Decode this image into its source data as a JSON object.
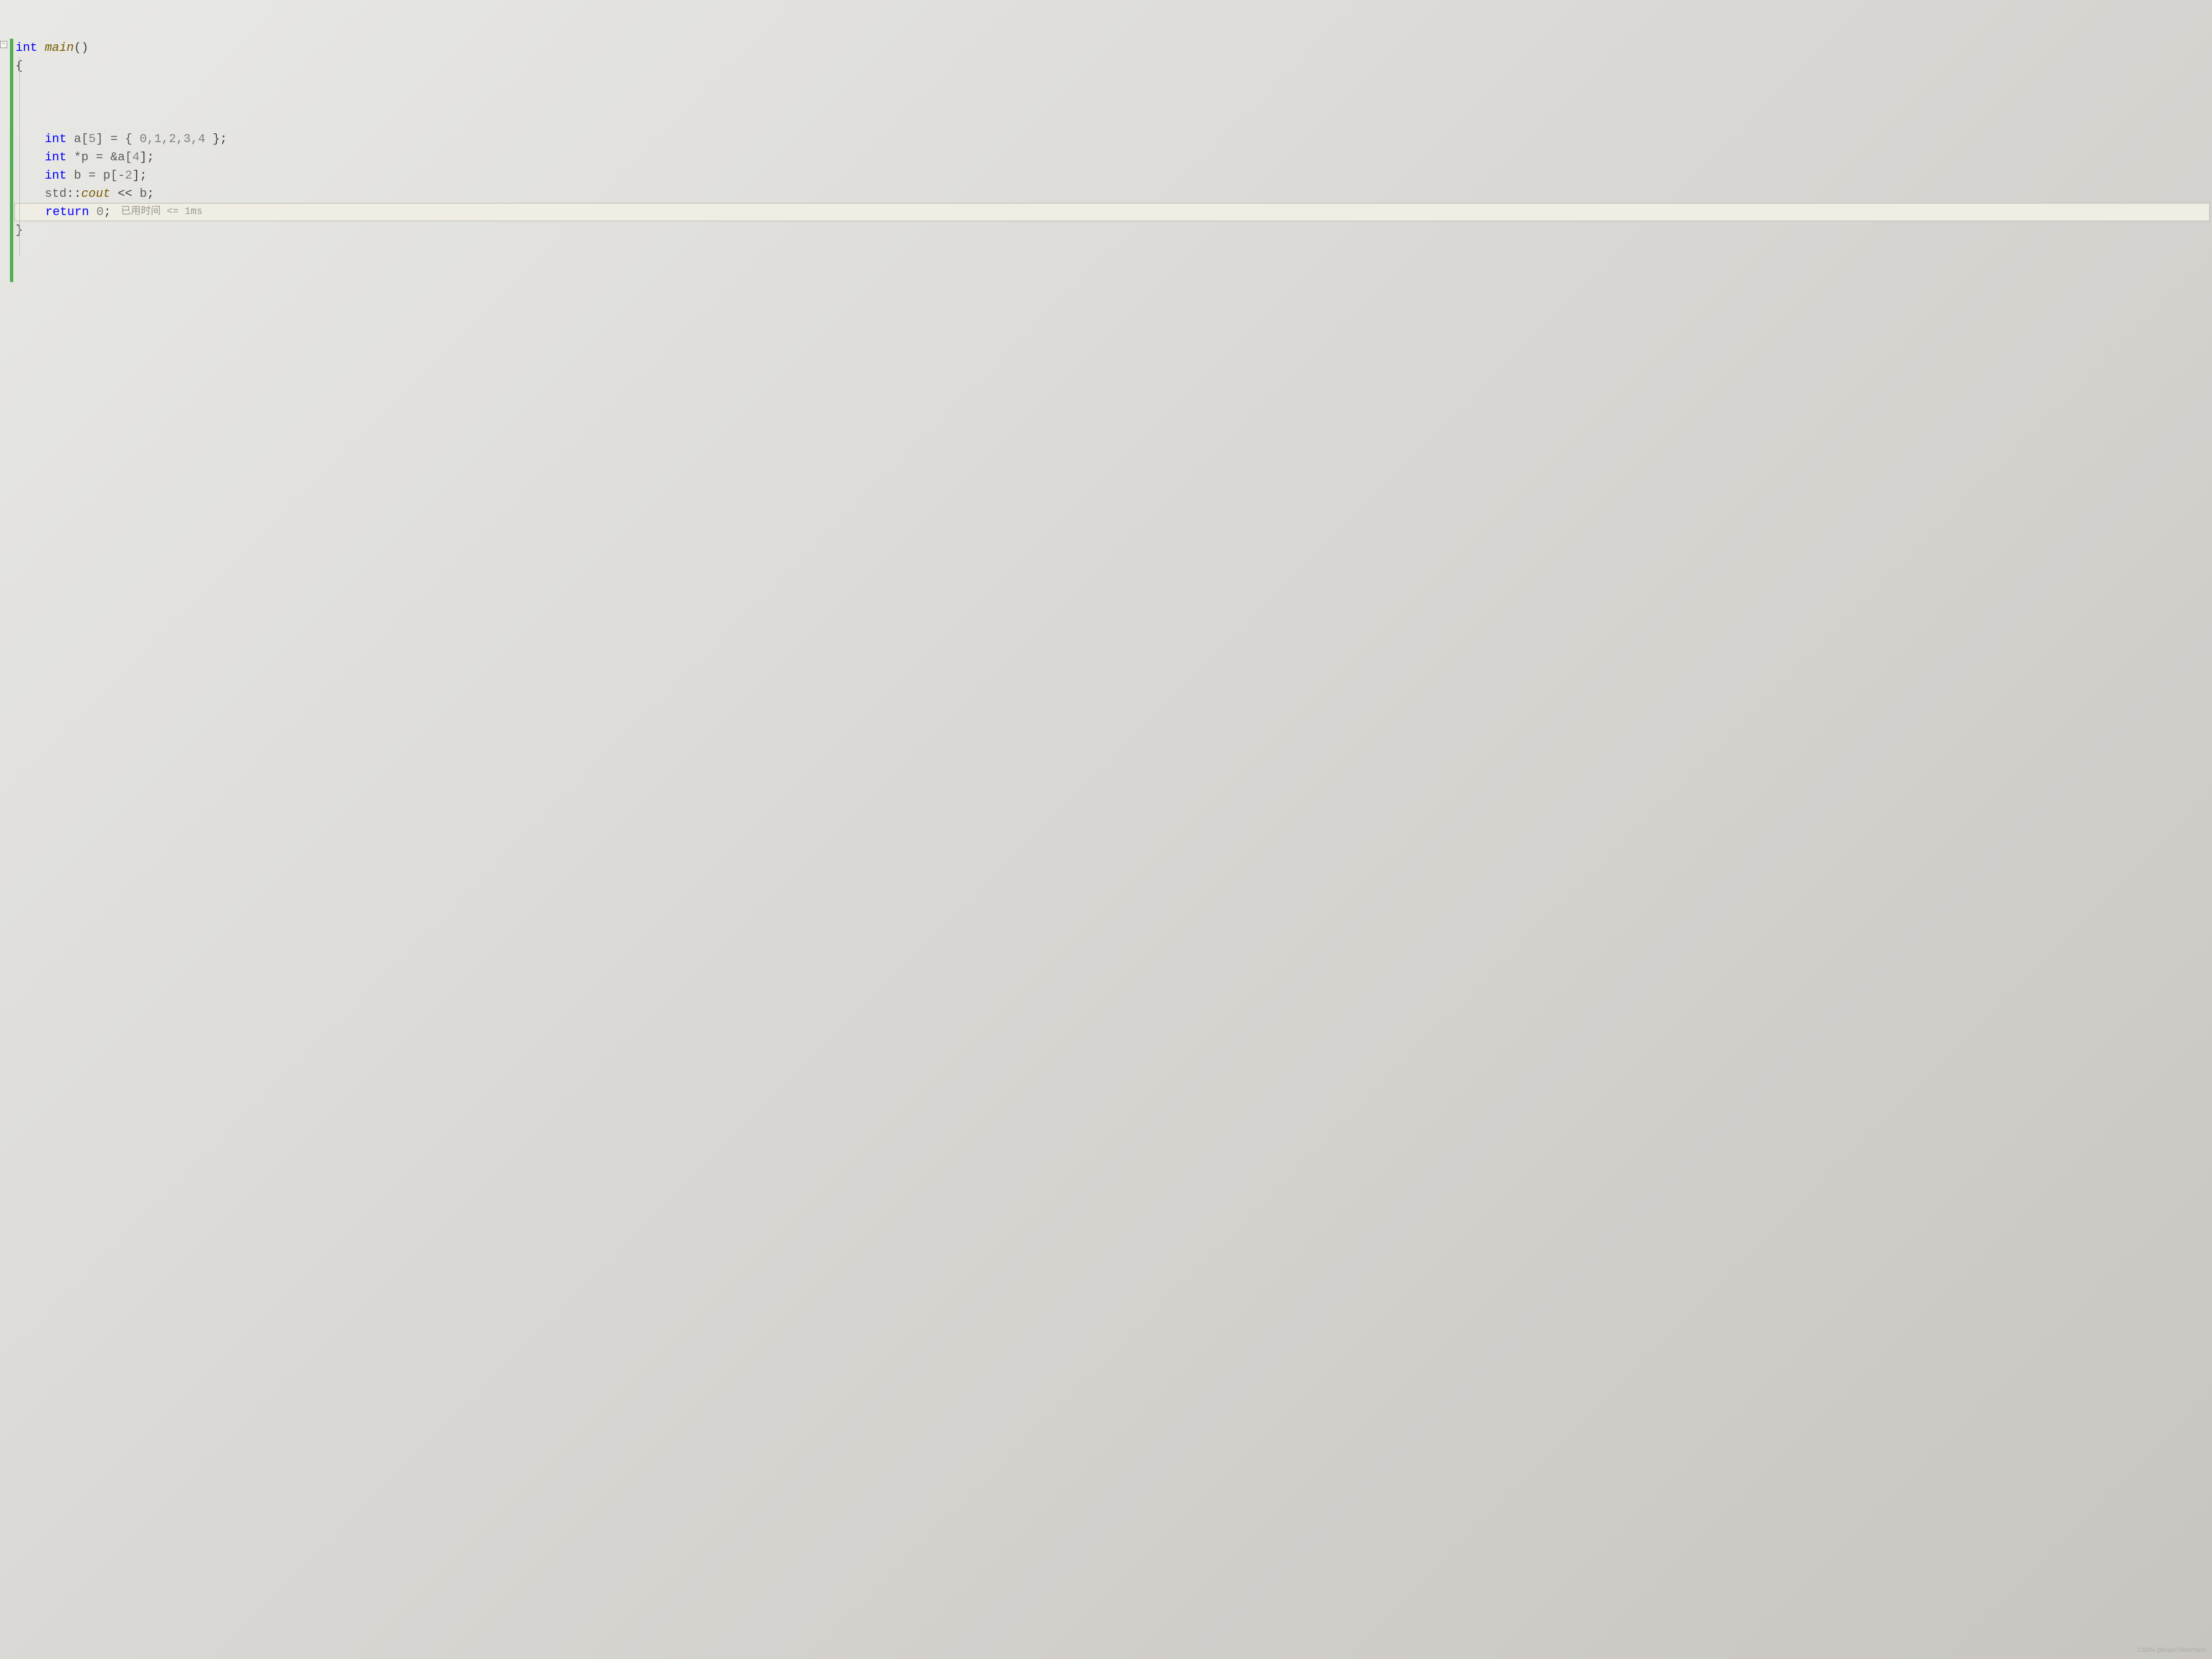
{
  "code": {
    "line1": {
      "keyword": "int",
      "function": "main",
      "parens": "()"
    },
    "line2": "{",
    "line3": {
      "keyword": "int",
      "decl": " a[",
      "size": "5",
      "decl2": "] = { ",
      "values": "0,1,2,3,4",
      "end": " };"
    },
    "line4": {
      "keyword": "int",
      "decl": " *p = &a[",
      "idx": "4",
      "end": "];"
    },
    "line5": {
      "keyword": "int",
      "decl": " b = p[-",
      "idx": "2",
      "end": "];"
    },
    "line6": {
      "ns": "std",
      "scope": "::",
      "stream": "cout",
      "op": " << ",
      "var": "b",
      "end": ";"
    },
    "line7": {
      "keyword": "return",
      "space": " ",
      "value": "0",
      "end": ";"
    },
    "line8": "}",
    "hint": "已用时间 <= 1ms"
  },
  "fold_symbol": "−",
  "watermark": "CSDN @kupeThinkPoem"
}
